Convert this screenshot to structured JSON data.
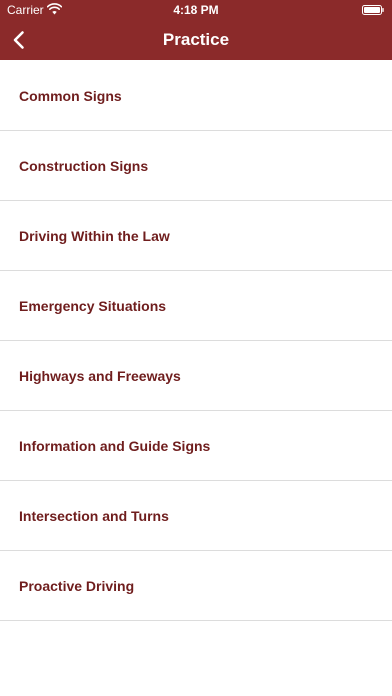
{
  "status_bar": {
    "carrier": "Carrier",
    "time": "4:18 PM"
  },
  "nav": {
    "title": "Practice",
    "back_icon": "chevron-left-icon"
  },
  "list": {
    "items": [
      {
        "label": "Common Signs"
      },
      {
        "label": "Construction Signs"
      },
      {
        "label": "Driving Within the Law"
      },
      {
        "label": "Emergency Situations"
      },
      {
        "label": "Highways and Freeways"
      },
      {
        "label": "Information and Guide Signs"
      },
      {
        "label": "Intersection and Turns"
      },
      {
        "label": "Proactive Driving"
      }
    ]
  },
  "colors": {
    "header": "#8b2a2a",
    "item_text": "#6f1d1d"
  }
}
